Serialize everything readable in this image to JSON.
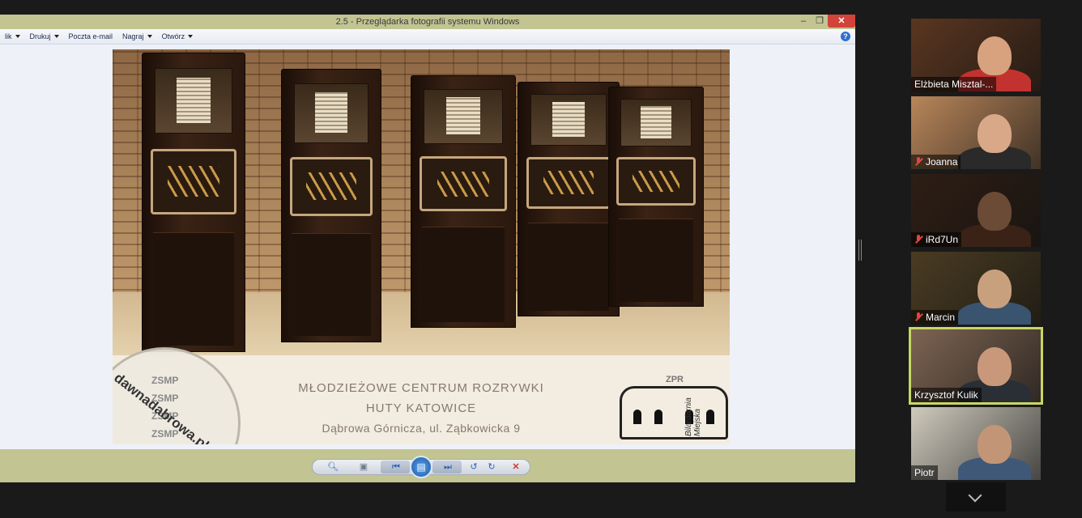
{
  "window": {
    "title": "2.5 - Przeglądarka fotografii systemu Windows",
    "minimize": "–",
    "restore": "❐",
    "close": "✕"
  },
  "menubar": {
    "items": [
      {
        "label": "lik"
      },
      {
        "label": "Drukuj"
      },
      {
        "label": "Poczta e-mail"
      },
      {
        "label": "Nagraj"
      },
      {
        "label": "Otwórz"
      }
    ],
    "help": "?"
  },
  "photo": {
    "caption_line1": "MŁODZIEŻOWE CENTRUM ROZRYWKI",
    "caption_line2": "HUTY KATOWICE",
    "caption_line3": "Dąbrowa Górnicza, ul. Ząbkowicka 9",
    "watermark": "dawnadabrowa.pl",
    "stamp_lines": [
      "ZSMP",
      "ZSMP",
      "ZSMP",
      "ZSMP"
    ],
    "logo_zpr": "ZPR",
    "logo_text": "Bilardarnia Miejska"
  },
  "controls": {
    "zoom_icon": "search-icon",
    "fit_icon": "fit-icon",
    "prev_icon": "previous-icon",
    "slideshow_icon": "slideshow-icon",
    "next_icon": "next-icon",
    "rotate_left_icon": "rotate-left-icon",
    "rotate_right_icon": "rotate-right-icon",
    "delete_icon": "delete-icon"
  },
  "participants": [
    {
      "name": "Elżbieta Misztal-...",
      "muted": false,
      "active": false,
      "bg": "#5a3620",
      "face": "#d8a27f",
      "body": "#c2332f"
    },
    {
      "name": "Joanna",
      "muted": true,
      "active": false,
      "bg": "#b8865a",
      "face": "#d9a888",
      "body": "#2a2a2a"
    },
    {
      "name": "iRd7Un",
      "muted": true,
      "active": false,
      "bg": "#2e1e14",
      "face": "#6b4a36",
      "body": "#3a2216"
    },
    {
      "name": "Marcin",
      "muted": true,
      "active": false,
      "bg": "#4a3c22",
      "face": "#c9a07e",
      "body": "#3a5470"
    },
    {
      "name": "Krzysztof Kulik",
      "muted": false,
      "active": true,
      "bg": "#7d6452",
      "face": "#c9987a",
      "body": "#2a2f36"
    },
    {
      "name": "Piotr",
      "muted": false,
      "active": false,
      "bg": "#cfcabd",
      "face": "#c29577",
      "body": "#3f5878"
    }
  ],
  "scroll_more": "chevron-down-icon"
}
